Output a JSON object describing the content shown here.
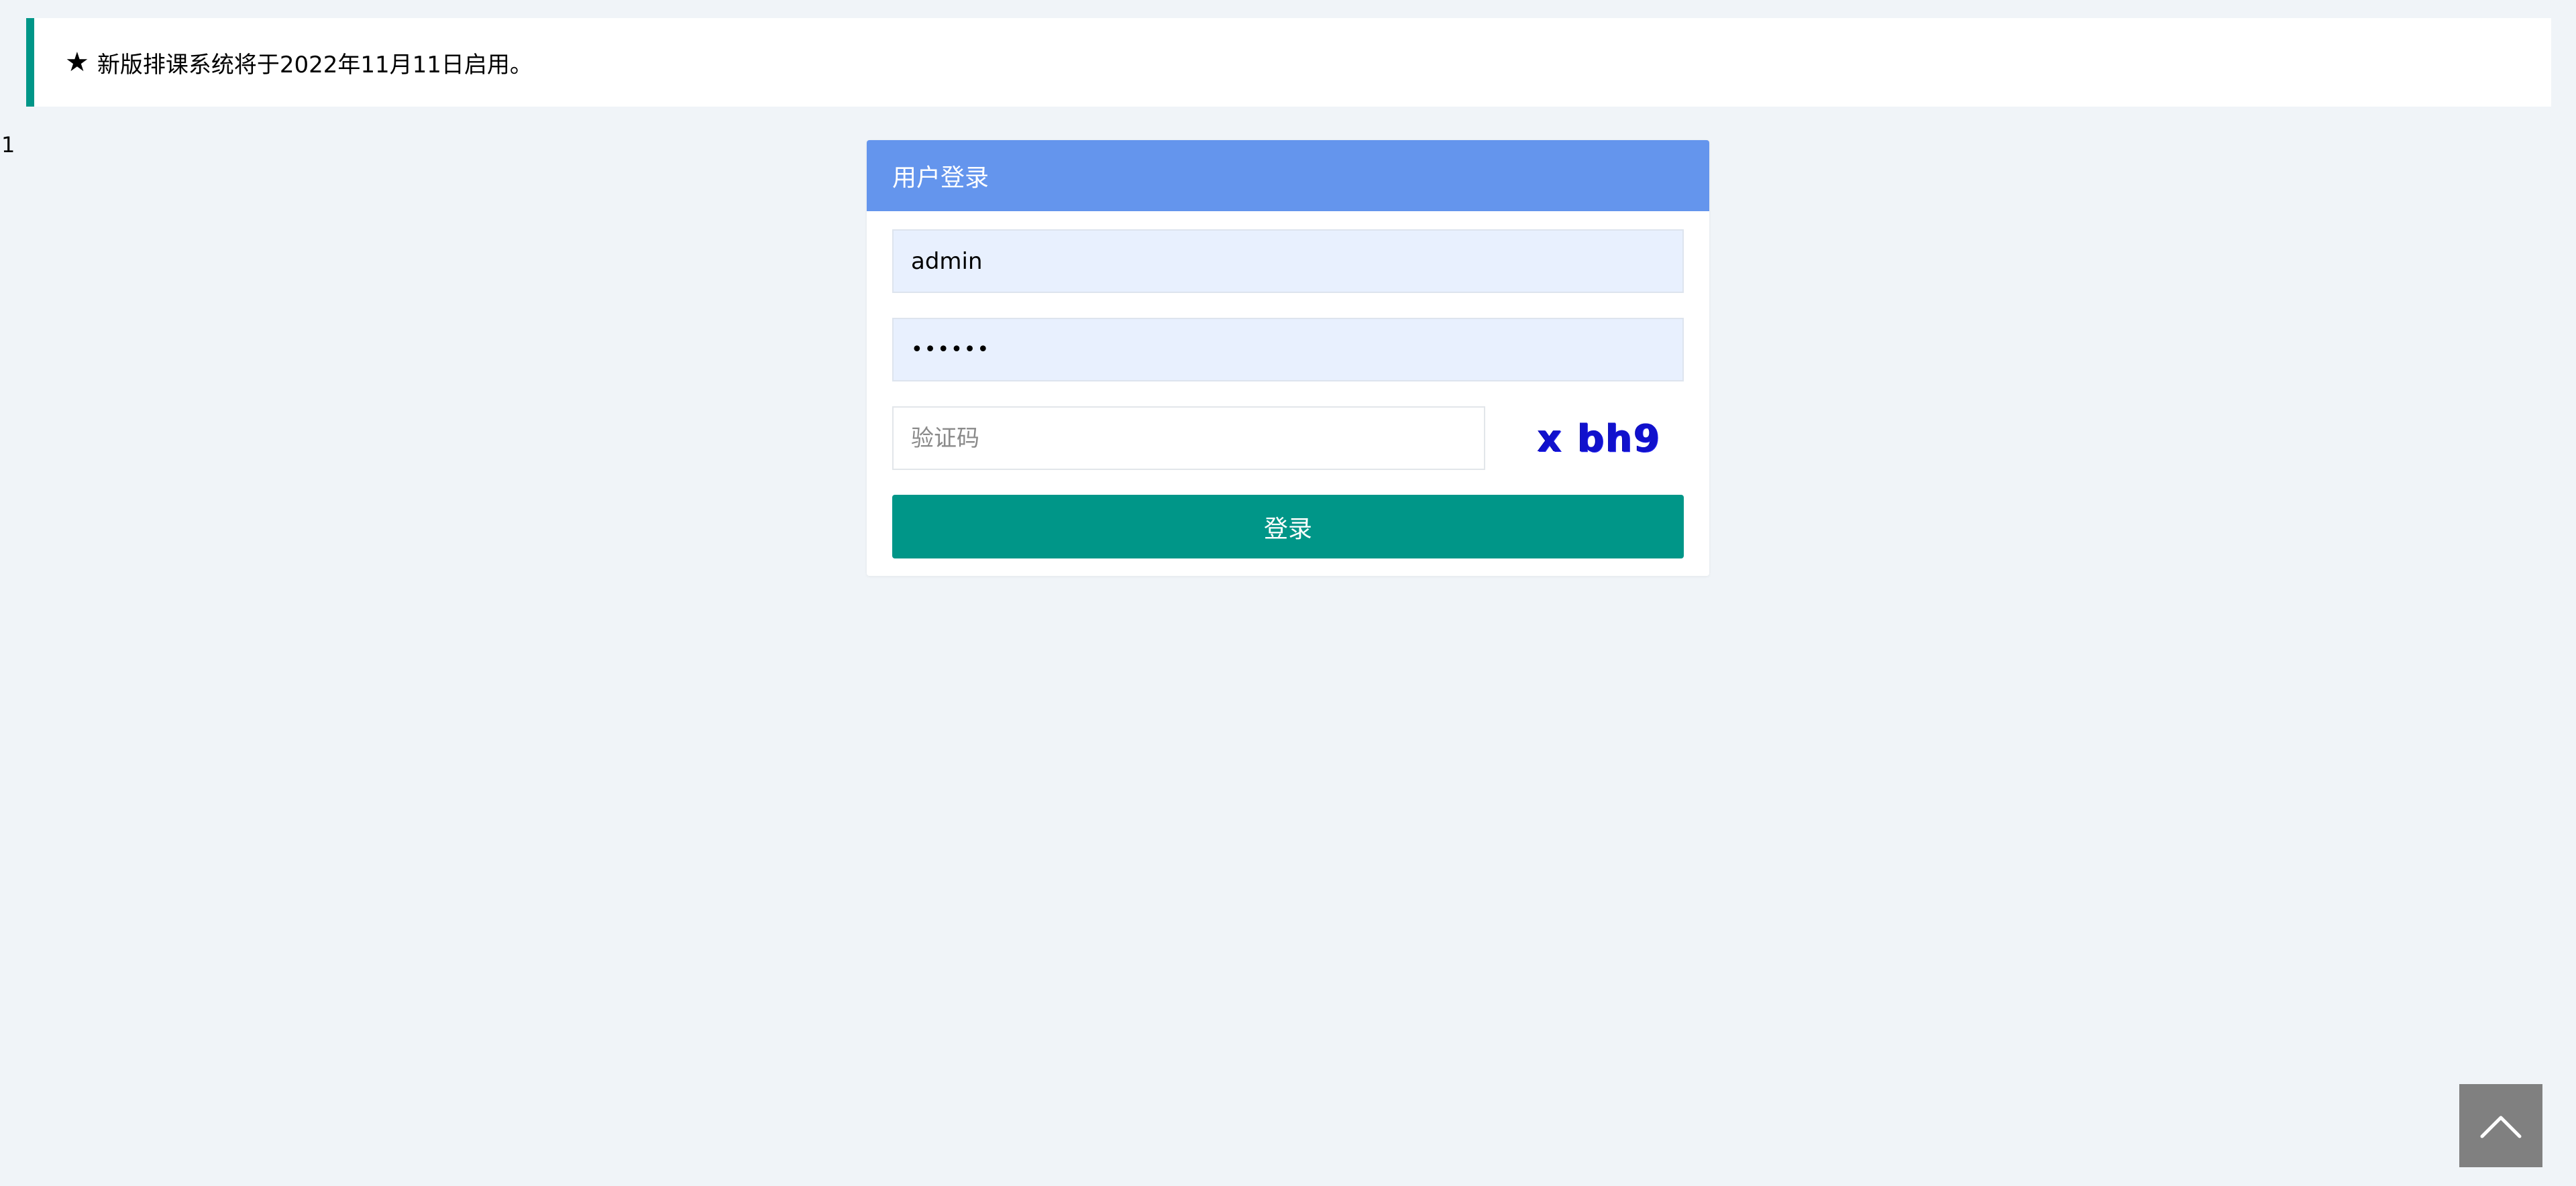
{
  "notice": {
    "icon": "star-icon",
    "text": "新版排课系统将于2022年11月11日启用。",
    "accent_color": "#009688"
  },
  "stray_text": "1",
  "login": {
    "title": "用户登录",
    "header_color": "#6495ed",
    "username_value": "admin",
    "password_value": "••••••",
    "captcha_placeholder": "验证码",
    "captcha_text": "x bh9",
    "submit_label": "登录",
    "button_color": "#009688"
  },
  "back_to_top": {
    "icon": "chevron-up-icon"
  }
}
